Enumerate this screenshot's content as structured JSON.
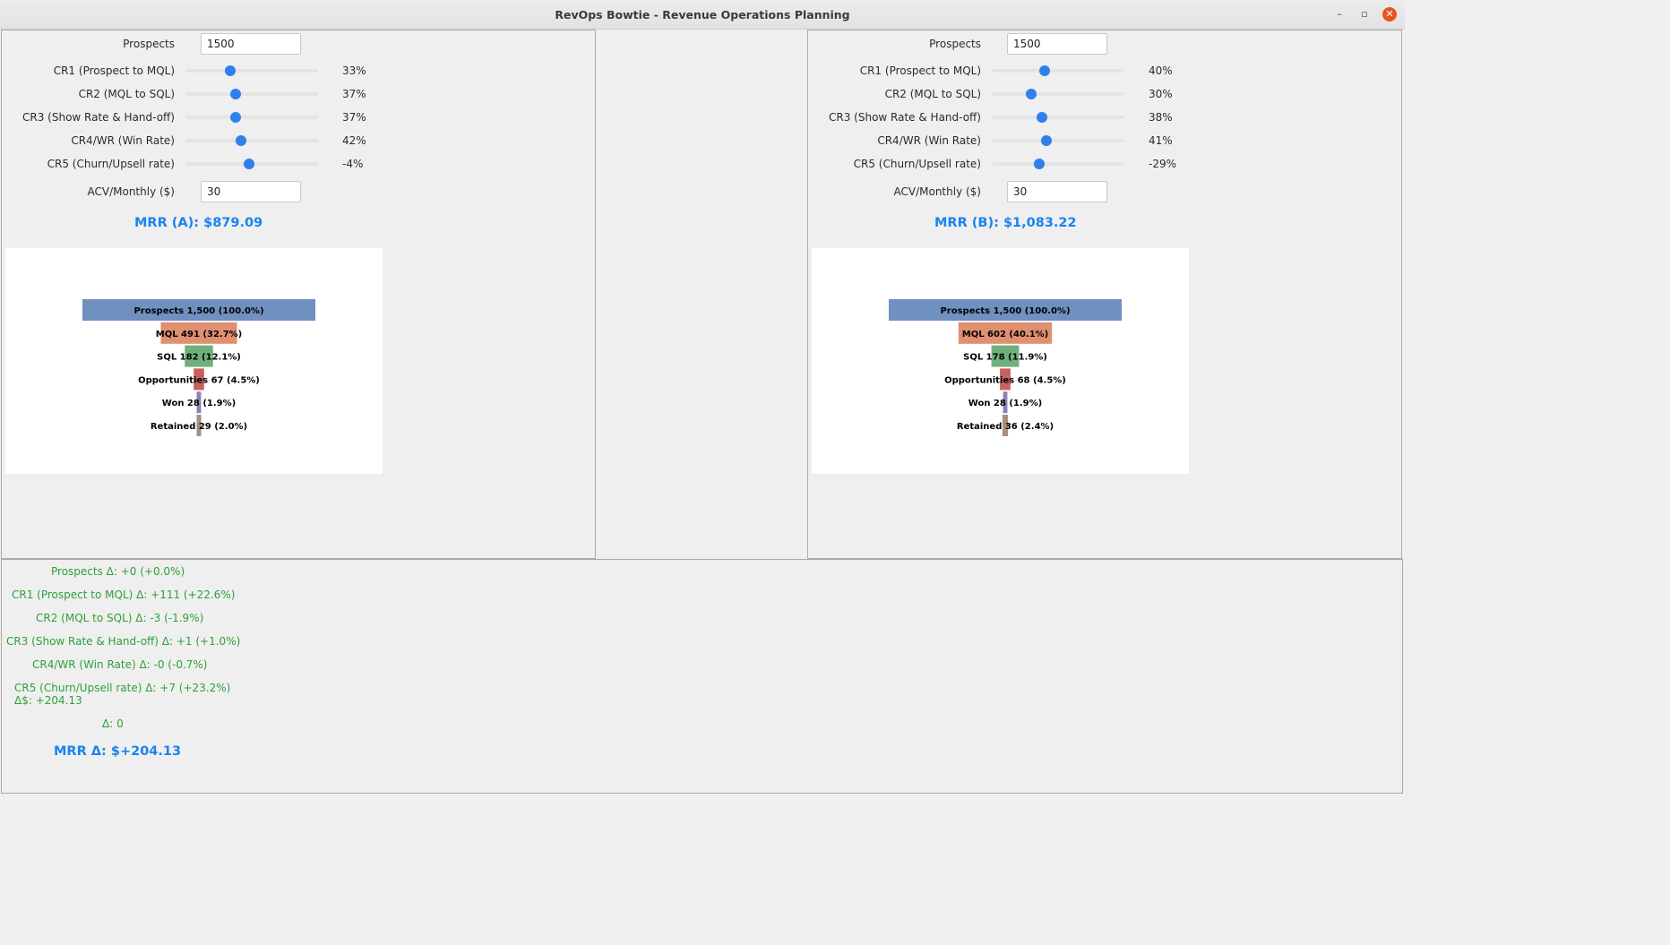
{
  "window": {
    "title": "RevOps Bowtie - Revenue Operations Planning",
    "minimize_label": "–",
    "maximize_label": "▫",
    "close_label": "✕"
  },
  "panel_a": {
    "prospects_label": "Prospects",
    "prospects_value": "1500",
    "sliders": [
      {
        "label": "CR1 (Prospect to MQL)",
        "pct_text": "33%",
        "level": 0.34
      },
      {
        "label": "CR2 (MQL to SQL)",
        "pct_text": "37%",
        "level": 0.38
      },
      {
        "label": "CR3 (Show Rate & Hand-off)",
        "pct_text": "37%",
        "level": 0.38
      },
      {
        "label": "CR4/WR (Win Rate)",
        "pct_text": "42%",
        "level": 0.42
      },
      {
        "label": "CR5 (Churn/Upsell rate)",
        "pct_text": "-4%",
        "level": 0.48
      }
    ],
    "acv_label": "ACV/Monthly ($)",
    "acv_value": "30",
    "mrr_text": "MRR (A): $879.09",
    "chart_data": {
      "type": "bar",
      "orientation": "horizontal-funnel",
      "categories": [
        "Prospects",
        "MQL",
        "SQL",
        "Opportunities",
        "Won",
        "Retained"
      ],
      "values": [
        1500,
        491,
        182,
        67,
        28,
        29
      ],
      "labels": [
        "Prospects 1,500 (100.0%)",
        "MQL 491 (32.7%)",
        "SQL 182 (12.1%)",
        "Opportunities 67 (4.5%)",
        "Won 28 (1.9%)",
        "Retained 29 (2.0%)"
      ],
      "colors": [
        "#7090c0",
        "#e09070",
        "#70b07a",
        "#c86060",
        "#9080b8",
        "#a89080"
      ]
    }
  },
  "panel_b": {
    "prospects_label": "Prospects",
    "prospects_value": "1500",
    "sliders": [
      {
        "label": "CR1 (Prospect to MQL)",
        "pct_text": "40%",
        "level": 0.4
      },
      {
        "label": "CR2 (MQL to SQL)",
        "pct_text": "30%",
        "level": 0.3
      },
      {
        "label": "CR3 (Show Rate & Hand-off)",
        "pct_text": "38%",
        "level": 0.38
      },
      {
        "label": "CR4/WR (Win Rate)",
        "pct_text": "41%",
        "level": 0.41
      },
      {
        "label": "CR5 (Churn/Upsell rate)",
        "pct_text": "-29%",
        "level": 0.36
      }
    ],
    "acv_label": "ACV/Monthly ($)",
    "acv_value": "30",
    "mrr_text": "MRR (B): $1,083.22",
    "chart_data": {
      "type": "bar",
      "orientation": "horizontal-funnel",
      "categories": [
        "Prospects",
        "MQL",
        "SQL",
        "Opportunities",
        "Won",
        "Retained"
      ],
      "values": [
        1500,
        602,
        178,
        68,
        28,
        36
      ],
      "labels": [
        "Prospects 1,500 (100.0%)",
        "MQL 602 (40.1%)",
        "SQL 178 (11.9%)",
        "Opportunities 68 (4.5%)",
        "Won 28 (1.9%)",
        "Retained 36 (2.4%)"
      ],
      "colors": [
        "#7090c0",
        "#e09070",
        "#70b07a",
        "#c86060",
        "#9080b8",
        "#a89080"
      ]
    }
  },
  "deltas": {
    "lines": [
      "Prospects Δ: +0 (+0.0%)",
      "CR1 (Prospect to MQL) Δ: +111 (+22.6%)",
      "CR2 (MQL to SQL) Δ: -3 (-1.9%)",
      "CR3 (Show Rate & Hand-off) Δ: +1 (+1.0%)",
      "CR4/WR (Win Rate) Δ: -0 (-0.7%)",
      "CR5 (Churn/Upsell rate) Δ: +7 (+23.2%)",
      "Δ$: +204.13",
      "Δ: 0"
    ],
    "mrr_delta_text": "MRR Δ: $+204.13",
    "color": "#2ea03a",
    "mrr_color": "#1a83f0"
  }
}
